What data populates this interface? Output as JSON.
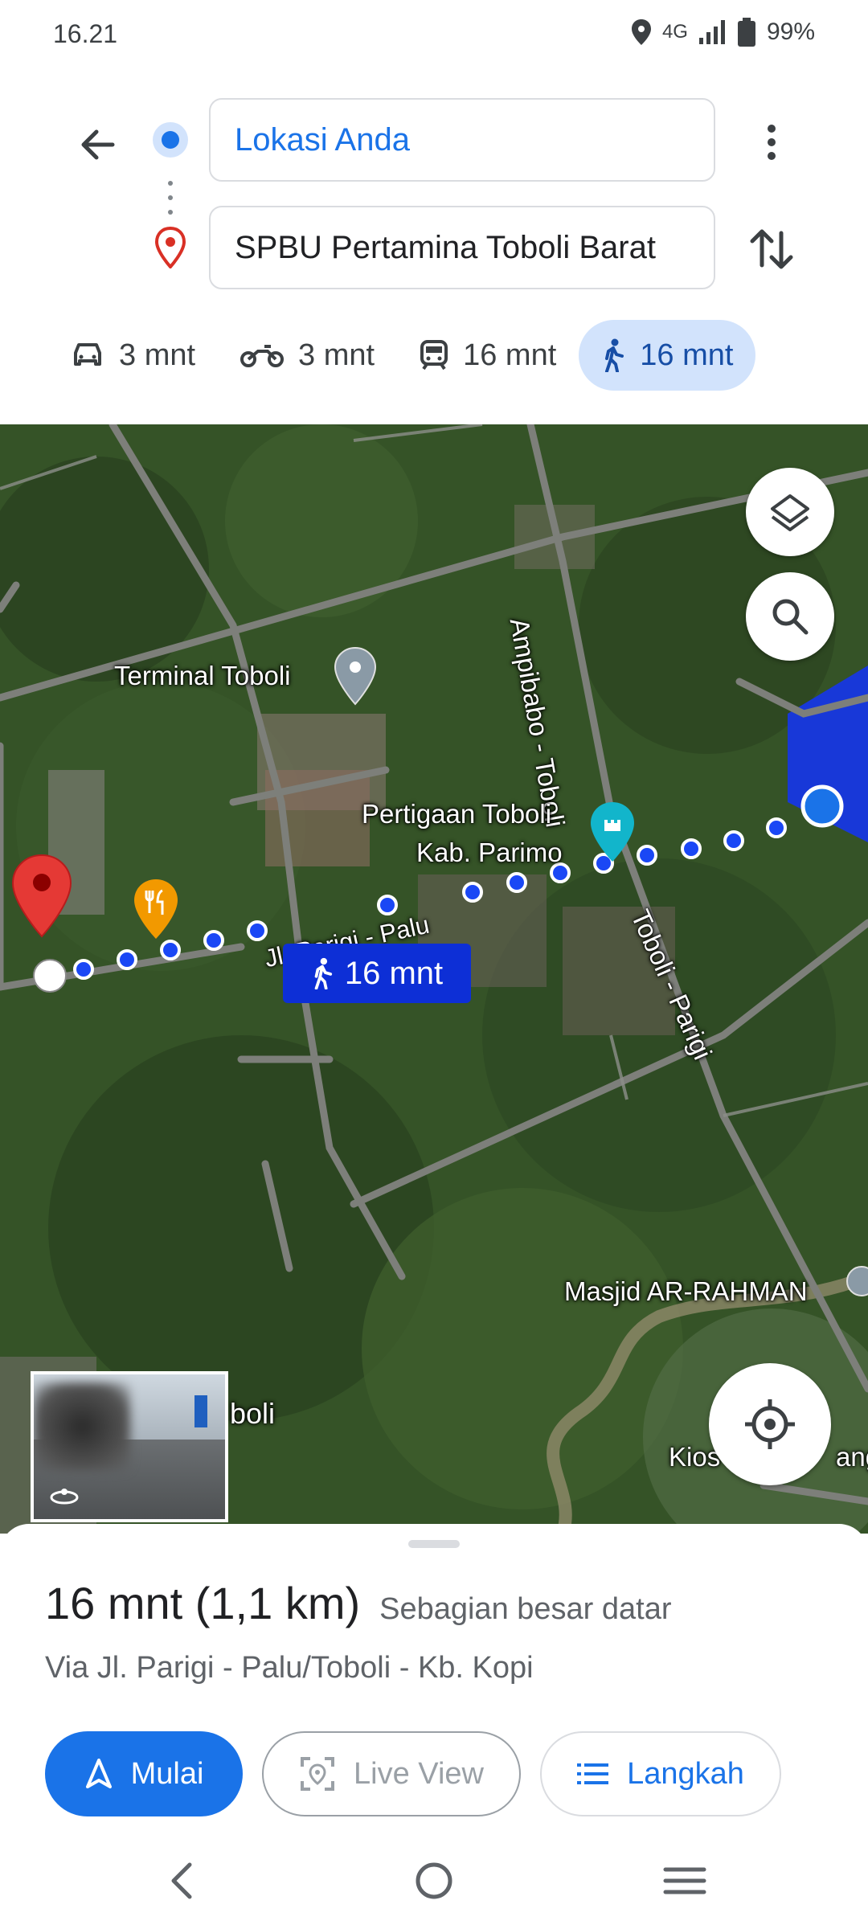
{
  "status_bar": {
    "time": "16.21",
    "network": "4G",
    "battery": "99%",
    "icons": [
      "location-icon",
      "signal-icon",
      "battery-icon"
    ]
  },
  "directions": {
    "origin": "Lokasi Anda",
    "destination": "SPBU Pertamina Toboli Barat",
    "modes": [
      {
        "name": "car",
        "icon": "car-icon",
        "label": "3 mnt"
      },
      {
        "name": "motorcycle",
        "icon": "motorcycle-icon",
        "label": "3 mnt"
      },
      {
        "name": "transit",
        "icon": "train-icon",
        "label": "16 mnt"
      },
      {
        "name": "walk",
        "icon": "walk-icon",
        "label": "16 mnt",
        "active": true
      }
    ]
  },
  "map": {
    "labels": {
      "terminal": "Terminal Toboli",
      "road_ampibabo": "Ampibabo - Toboli",
      "pertigaan_line1": "Pertigaan Toboli",
      "pertigaan_line2": "Kab. Parimo",
      "road_parigi_palu": "Jl. Parigi - Palu",
      "road_toboli_parigi": "Toboli - Parigi",
      "masjid": "Masjid AR-RAHMAN",
      "toboli_partial": "boli",
      "kios_partial": "Kios",
      "kios_partial_right": "ang"
    },
    "route_chip": "16 mnt",
    "colors": {
      "route": "#1a47f5",
      "destination_pin": "#e53935",
      "restaurant": "#f29900",
      "landmark": "#12b5cb"
    }
  },
  "sheet": {
    "duration": "16 mnt (1,1 km)",
    "terrain": "Sebagian besar datar",
    "via": "Via Jl. Parigi - Palu/Toboli - Kb. Kopi",
    "buttons": {
      "start": "Mulai",
      "live_view": "Live View",
      "steps": "Langkah"
    }
  }
}
